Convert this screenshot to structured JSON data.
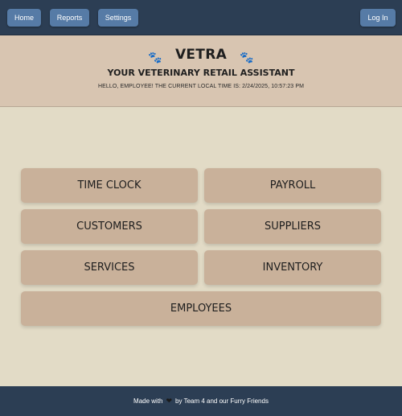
{
  "nav": {
    "home": "Home",
    "reports": "Reports",
    "settings": "Settings",
    "login": "Log In"
  },
  "header": {
    "brand": "VETRA",
    "subtitle": "Your Veterinary Retail Assistant",
    "greeting": "Hello, Employee! The current local time is: 2/24/2025, 10:57:23 PM",
    "paw_icon": "🐾"
  },
  "tiles": {
    "time_clock": "Time Clock",
    "payroll": "Payroll",
    "customers": "Customers",
    "suppliers": "Suppliers",
    "services": "Services",
    "inventory": "Inventory",
    "employees": "Employees"
  },
  "footer": {
    "prefix": "Made with",
    "heart_icon": "❤",
    "suffix": "by Team 4 and our Furry Friends"
  },
  "colors": {
    "nav_bg": "#2c3e54",
    "nav_button": "#567ba6",
    "header_bg": "#d8c5b1",
    "page_bg": "#e2dbc6",
    "tile_bg": "#c9b19a",
    "paw": "#6f5a92"
  }
}
